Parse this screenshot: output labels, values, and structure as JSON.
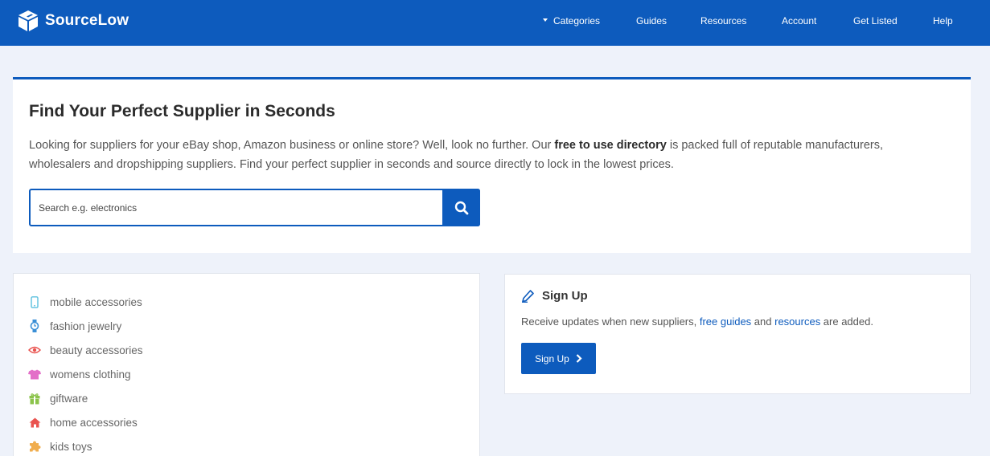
{
  "brand": {
    "name": "SourceLow"
  },
  "nav": {
    "categories": "Categories",
    "guides": "Guides",
    "resources": "Resources",
    "account": "Account",
    "get_listed": "Get Listed",
    "help": "Help"
  },
  "hero": {
    "title": "Find Your Perfect Supplier in Seconds",
    "text_before": "Looking for suppliers for your eBay shop, Amazon business or online store? Well, look no further. Our ",
    "text_bold": "free to use directory",
    "text_after": " is packed full of reputable manufacturers, wholesalers and dropshipping suppliers. Find your perfect supplier in seconds and source directly to lock in the lowest prices.",
    "search_placeholder": "Search e.g. electronics",
    "search_icon": "search-icon"
  },
  "categories": [
    {
      "label": "mobile accessories",
      "icon": "mobile-phone-icon",
      "color": "#5bc0de"
    },
    {
      "label": "fashion jewelry",
      "icon": "watch-icon",
      "color": "#3a8fd6"
    },
    {
      "label": "beauty accessories",
      "icon": "eye-icon",
      "color": "#e9534f"
    },
    {
      "label": "womens clothing",
      "icon": "tshirt-icon",
      "color": "#e36fc8"
    },
    {
      "label": "giftware",
      "icon": "gift-icon",
      "color": "#8bc34a"
    },
    {
      "label": "home accessories",
      "icon": "home-icon",
      "color": "#e9534f"
    },
    {
      "label": "kids toys",
      "icon": "puzzle-icon",
      "color": "#f0ad4e"
    }
  ],
  "signup": {
    "title": "Sign Up",
    "icon": "pencil-icon",
    "text_before": "Receive updates when new suppliers, ",
    "link_guides": "free guides",
    "text_mid": " and ",
    "link_resources": "resources",
    "text_after": " are added.",
    "button_label": "Sign Up"
  },
  "colors": {
    "brand_blue": "#0d5bbd",
    "background": "#eef2fa"
  }
}
